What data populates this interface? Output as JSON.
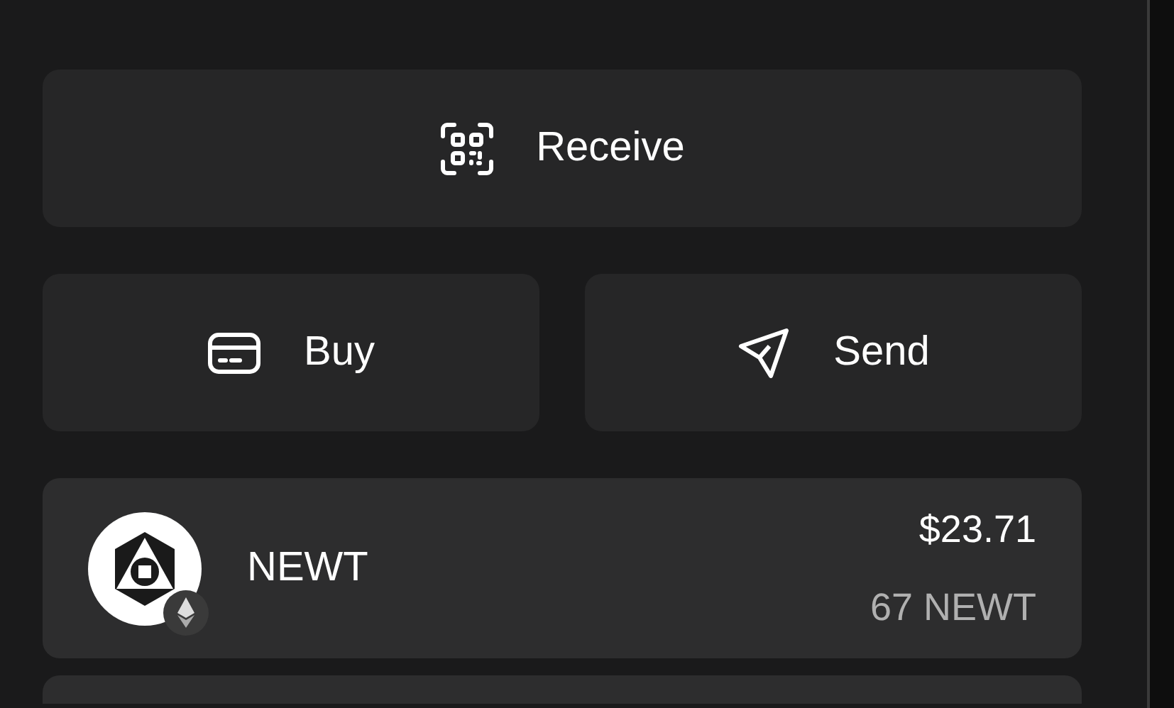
{
  "actions": [
    {
      "kind": "receive",
      "label": "Receive"
    },
    {
      "kind": "buy",
      "label": "Buy"
    },
    {
      "kind": "send",
      "label": "Send"
    }
  ],
  "tokens": [
    {
      "symbol": "NEWT",
      "value": "$23.71",
      "amount": "67 NEWT"
    }
  ]
}
